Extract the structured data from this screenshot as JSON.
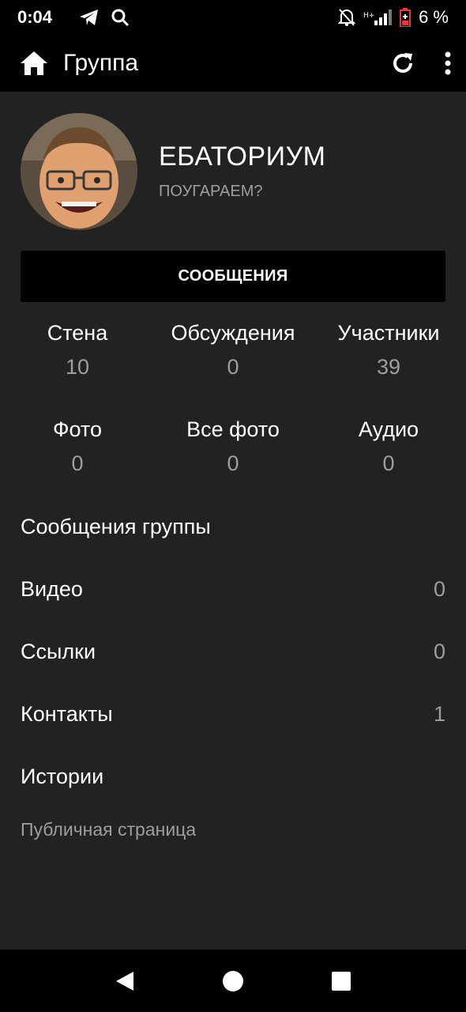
{
  "status_bar": {
    "time": "0:04",
    "battery": "6 %",
    "icons": [
      "telegram-icon",
      "search-icon",
      "bell-off-icon",
      "signal-icon",
      "battery-icon"
    ]
  },
  "app_bar": {
    "title": "Группа",
    "icons": [
      "home-icon",
      "refresh-icon",
      "more-vert-icon"
    ]
  },
  "group": {
    "name": "ЕБАТОРИУМ",
    "status": "ПОУГАРАЕМ?"
  },
  "messages_button": "СООБЩЕНИЯ",
  "counters": [
    {
      "label": "Стена",
      "value": "10"
    },
    {
      "label": "Обсуждения",
      "value": "0"
    },
    {
      "label": "Участники",
      "value": "39"
    },
    {
      "label": "Фото",
      "value": "0"
    },
    {
      "label": "Все фото",
      "value": "0"
    },
    {
      "label": "Аудио",
      "value": "0"
    }
  ],
  "rows": [
    {
      "label": "Сообщения группы",
      "count": ""
    },
    {
      "label": "Видео",
      "count": "0"
    },
    {
      "label": "Ссылки",
      "count": "0"
    },
    {
      "label": "Контакты",
      "count": "1"
    },
    {
      "label": "Истории",
      "count": ""
    }
  ],
  "page_type": "Публичная страница",
  "colors": {
    "background": "#222222",
    "bars": "#000000",
    "muted_text": "#9e9e9e",
    "battery_low": "#e53935"
  }
}
